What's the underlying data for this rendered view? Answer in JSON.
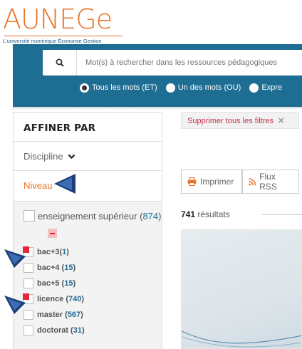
{
  "logo": {
    "title": "AUNEGe",
    "tagline": "L'université numérique Économie Gestion",
    "brand_color": "#e8742a",
    "tagline_color": "#1d5a8a"
  },
  "search": {
    "placeholder": "Mot(s) à rechercher dans les ressources pédagogiques",
    "value": "",
    "icon": "search-icon",
    "band_color": "#1e6d93",
    "options": [
      {
        "label": "Tous les mots (ET)",
        "selected": true
      },
      {
        "label": "Un des mots (OU)",
        "selected": false
      },
      {
        "label": "Expre",
        "selected": false
      }
    ]
  },
  "sidebar": {
    "title": "AFFINER PAR",
    "discipline": "Discipline",
    "niveau": "Niveau",
    "parent": {
      "label": "enseignement supérieur",
      "count": "874",
      "checked": false
    },
    "items": [
      {
        "label": "bac+3",
        "count": "1",
        "checked": true
      },
      {
        "label": "bac+4",
        "count": "15",
        "checked": false
      },
      {
        "label": "bac+5",
        "count": "15",
        "checked": false
      },
      {
        "label": "licence",
        "count": "740",
        "checked": true
      },
      {
        "label": "master",
        "count": "567",
        "checked": false
      },
      {
        "label": "doctorat",
        "count": "31",
        "checked": false
      }
    ]
  },
  "filters": {
    "clear_all": "Supprimer tous les filtres",
    "clear_icon": "close-icon",
    "accent": "#c6324a"
  },
  "toolbar": {
    "print": "Imprimer",
    "rss": "Flux RSS"
  },
  "results": {
    "count": "741",
    "label": "résultats"
  }
}
